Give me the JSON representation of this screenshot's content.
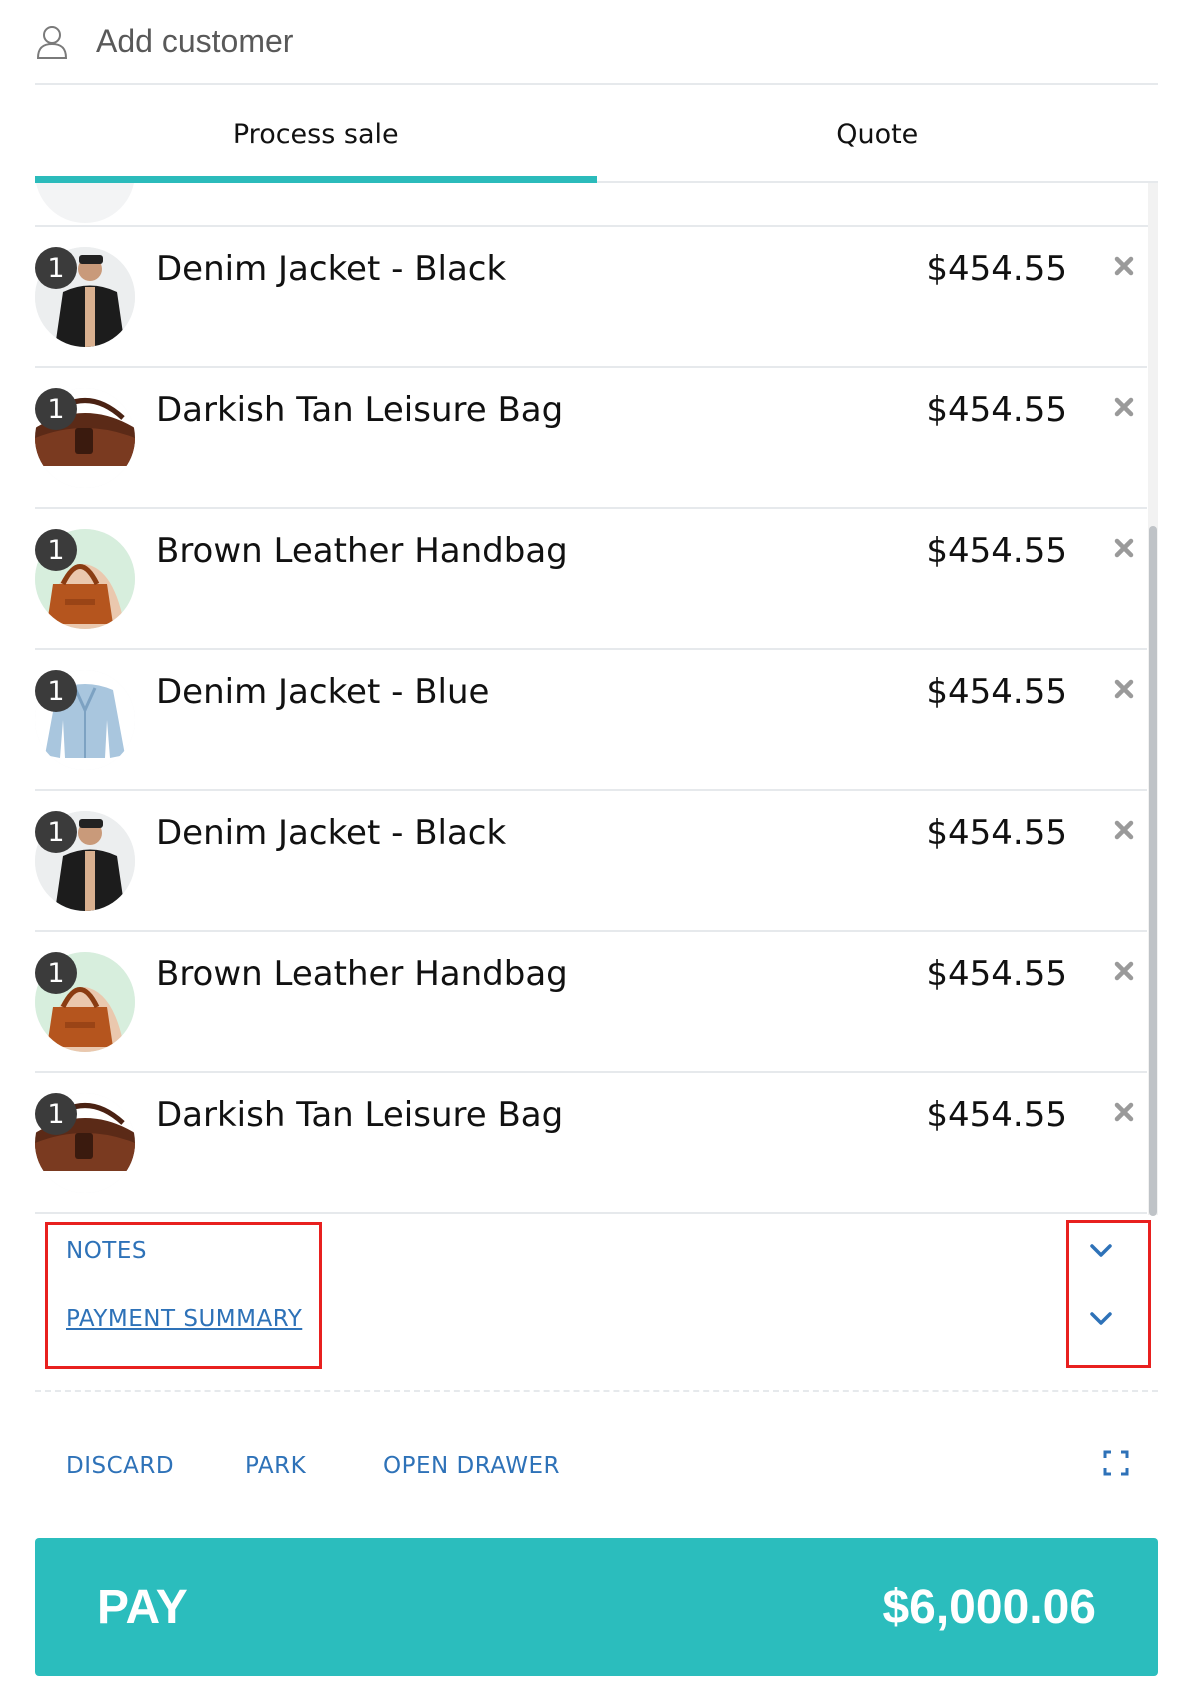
{
  "header": {
    "add_customer_label": "Add customer",
    "icon": "user-icon"
  },
  "tabs": [
    {
      "label": "Process sale",
      "active": true
    },
    {
      "label": "Quote",
      "active": false
    }
  ],
  "items": [
    {
      "qty": "1",
      "name": "Denim Jacket - Black",
      "price": "$454.55",
      "thumb": "black-jacket"
    },
    {
      "qty": "1",
      "name": "Darkish Tan Leisure Bag",
      "price": "$454.55",
      "thumb": "tan-bag"
    },
    {
      "qty": "1",
      "name": "Brown Leather Handbag",
      "price": "$454.55",
      "thumb": "brown-handbag"
    },
    {
      "qty": "1",
      "name": "Denim Jacket - Blue",
      "price": "$454.55",
      "thumb": "blue-jacket"
    },
    {
      "qty": "1",
      "name": "Denim Jacket - Black",
      "price": "$454.55",
      "thumb": "black-jacket"
    },
    {
      "qty": "1",
      "name": "Brown Leather Handbag",
      "price": "$454.55",
      "thumb": "brown-handbag"
    },
    {
      "qty": "1",
      "name": "Darkish Tan Leisure Bag",
      "price": "$454.55",
      "thumb": "tan-bag"
    }
  ],
  "accordion": {
    "notes_label": "NOTES",
    "summary_label": "PAYMENT SUMMARY"
  },
  "actions": {
    "discard": "DISCARD",
    "park": "PARK",
    "open_drawer": "OPEN DRAWER"
  },
  "pay": {
    "label": "PAY",
    "total": "$6,000.06"
  },
  "colors": {
    "accent": "#2bbdbd",
    "link": "#2e72b8",
    "highlight": "#e8201f"
  }
}
